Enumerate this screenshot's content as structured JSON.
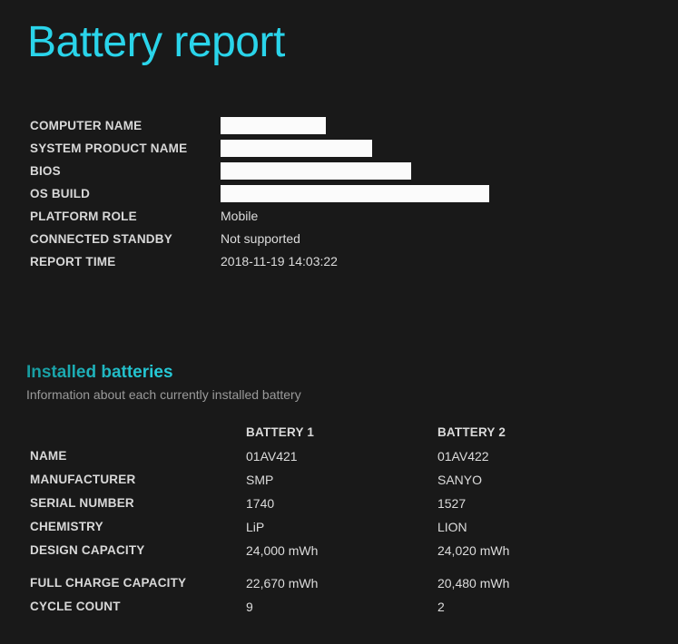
{
  "page": {
    "title": "Battery report",
    "accent_color": "#2ad4ea",
    "background_color": "#191919",
    "label_color": "#d8d8d8",
    "value_color": "#dcdcdc",
    "subtitle_color": "#9a9a9a",
    "redaction_color": "#fbfbfb"
  },
  "system_info": {
    "rows": [
      {
        "label": "COMPUTER NAME",
        "value": "",
        "redacted": true,
        "redaction_width": 116
      },
      {
        "label": "SYSTEM PRODUCT NAME",
        "value": "",
        "redacted": true,
        "redaction_width": 167
      },
      {
        "label": "BIOS",
        "value": "",
        "redacted": true,
        "redaction_width": 210
      },
      {
        "label": "OS BUILD",
        "value": "",
        "redacted": true,
        "redaction_width": 296
      },
      {
        "label": "PLATFORM ROLE",
        "value": "Mobile",
        "redacted": false
      },
      {
        "label": "CONNECTED STANDBY",
        "value": "Not supported",
        "redacted": false
      },
      {
        "label": "REPORT TIME",
        "value": "2018-11-19  14:03:22",
        "redacted": false
      }
    ]
  },
  "installed_batteries": {
    "section_title": "Installed batteries",
    "section_subtitle": "Information about each currently installed battery",
    "columns": [
      "",
      "BATTERY 1",
      "BATTERY 2"
    ],
    "rows": [
      {
        "label": "NAME",
        "battery1": "01AV421",
        "battery2": "01AV422"
      },
      {
        "label": "MANUFACTURER",
        "battery1": "SMP",
        "battery2": "SANYO"
      },
      {
        "label": "SERIAL NUMBER",
        "battery1": "1740",
        "battery2": "1527"
      },
      {
        "label": "CHEMISTRY",
        "battery1": "LiP",
        "battery2": "LION"
      },
      {
        "label": "DESIGN CAPACITY",
        "battery1": "24,000 mWh",
        "battery2": "24,020 mWh"
      },
      {
        "label": "FULL CHARGE CAPACITY",
        "battery1": "22,670 mWh",
        "battery2": "20,480 mWh"
      },
      {
        "label": "CYCLE COUNT",
        "battery1": "9",
        "battery2": "2"
      }
    ]
  }
}
